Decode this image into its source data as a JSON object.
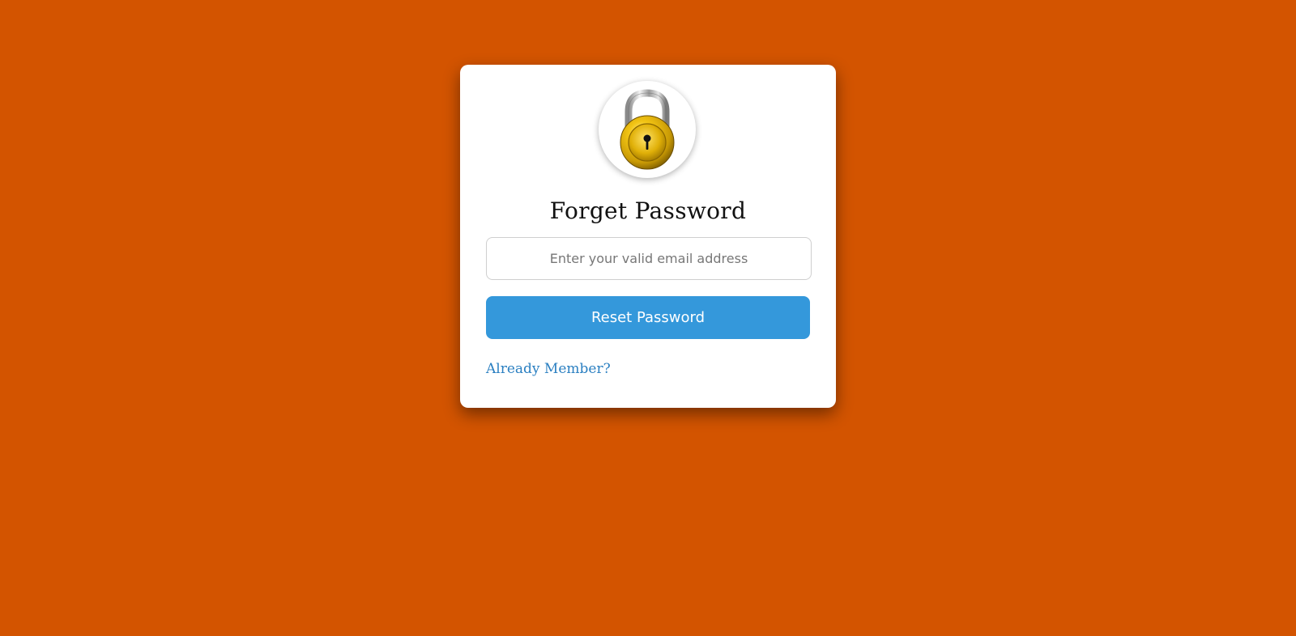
{
  "form": {
    "icon": "lock-icon",
    "title": "Forget Password",
    "email_placeholder": "Enter your valid email address",
    "email_value": "",
    "submit_label": "Reset Password",
    "member_link": "Already Member?"
  },
  "colors": {
    "background": "#d35400",
    "card": "#ffffff",
    "button": "#3498db",
    "link": "#2a7fc1"
  }
}
